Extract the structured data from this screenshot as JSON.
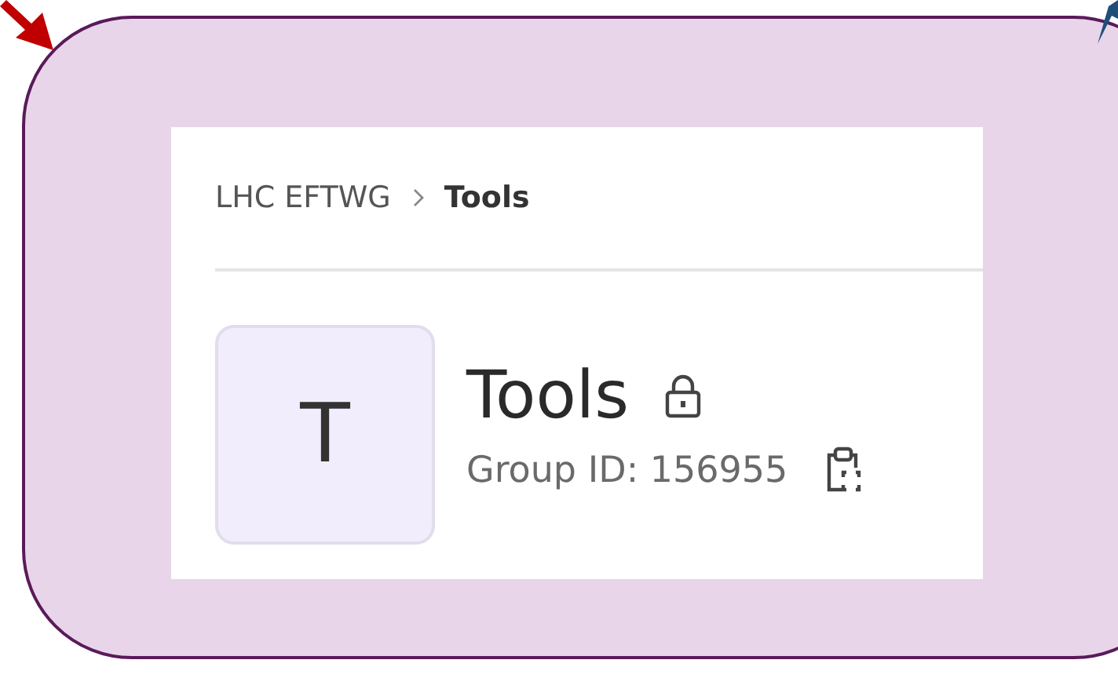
{
  "breadcrumb": [
    {
      "label": "LHC EFTWG",
      "current": false
    },
    {
      "label": "Tools",
      "current": true
    }
  ],
  "group": {
    "avatar": "T",
    "title": "Tools",
    "locked": true,
    "group_id": "Group ID: 156955"
  }
}
